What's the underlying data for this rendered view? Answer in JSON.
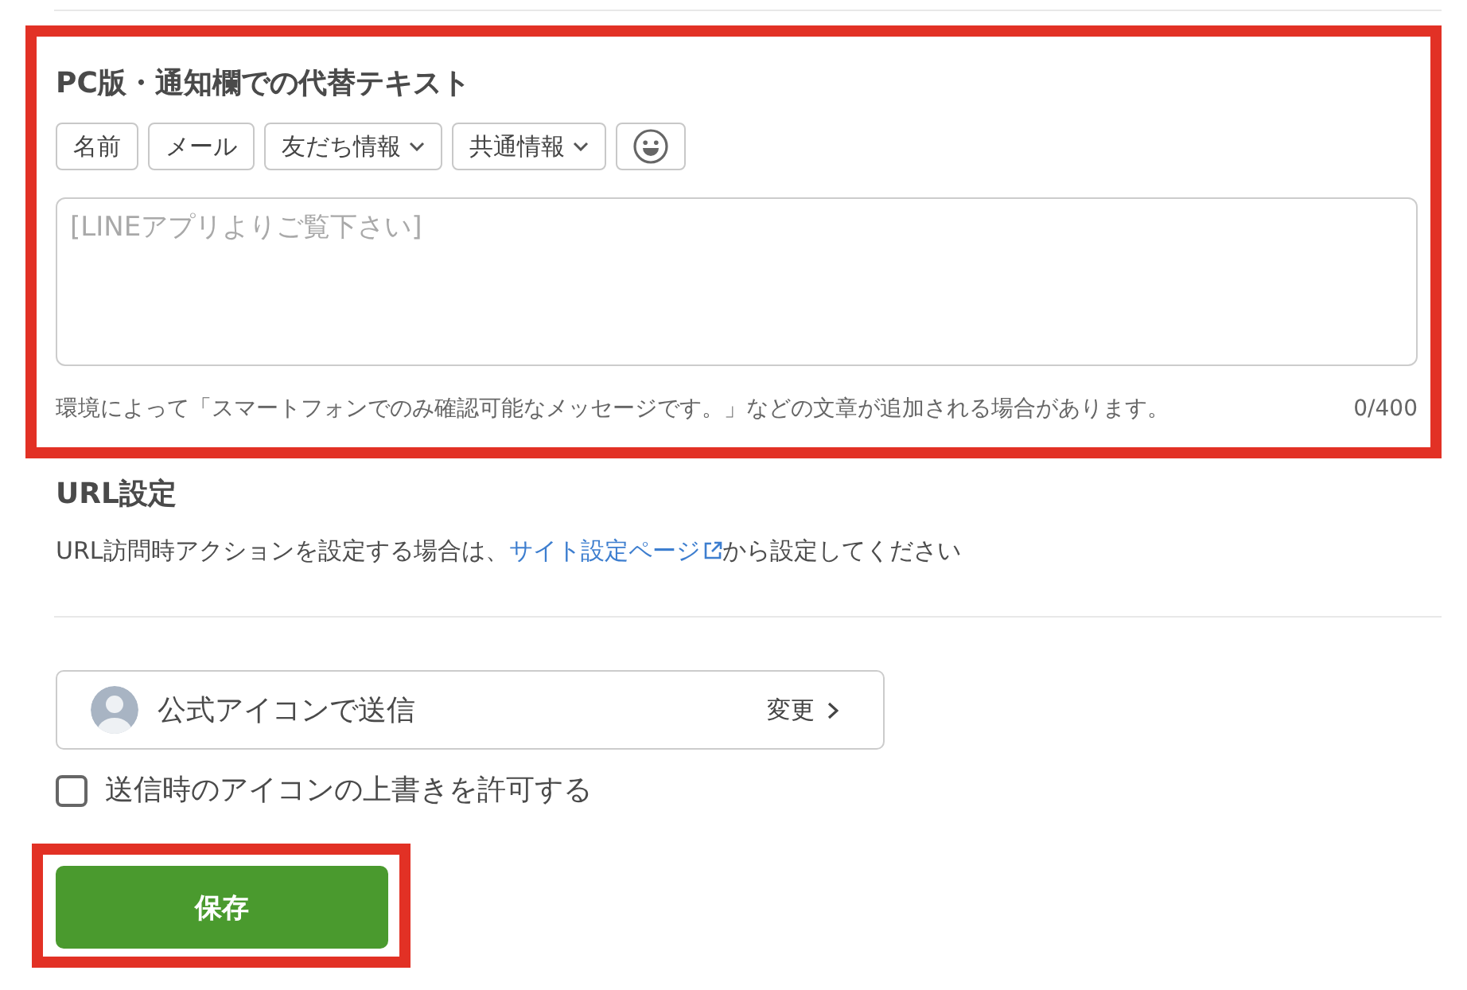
{
  "alt_text": {
    "highlighted": true,
    "title": "PC版・通知欄での代替テキスト",
    "insert_buttons": [
      {
        "kind": "plain",
        "label": "名前"
      },
      {
        "kind": "plain",
        "label": "メール"
      },
      {
        "kind": "dropdown",
        "label": "友だち情報"
      },
      {
        "kind": "dropdown",
        "label": "共通情報"
      },
      {
        "kind": "emoji"
      }
    ],
    "textarea": {
      "placeholder": "[LINEアプリよりご覧下さい]"
    },
    "note": "環境によって「スマートフォンでのみ確認可能なメッセージです。」などの文章が追加される場合があります。",
    "counter": "0/400"
  },
  "url_settings": {
    "title": "URL設定",
    "text_before": "URL訪問時アクションを設定する場合は、",
    "link": "サイト設定ページ",
    "text_after": "から設定してください"
  },
  "sender_icon": {
    "label": "公式アイコンで送信",
    "action": "変更"
  },
  "override_checkbox": {
    "label": "送信時のアイコンの上書きを許可する",
    "checked": false
  },
  "save_button": {
    "label": "保存",
    "highlighted": true
  }
}
